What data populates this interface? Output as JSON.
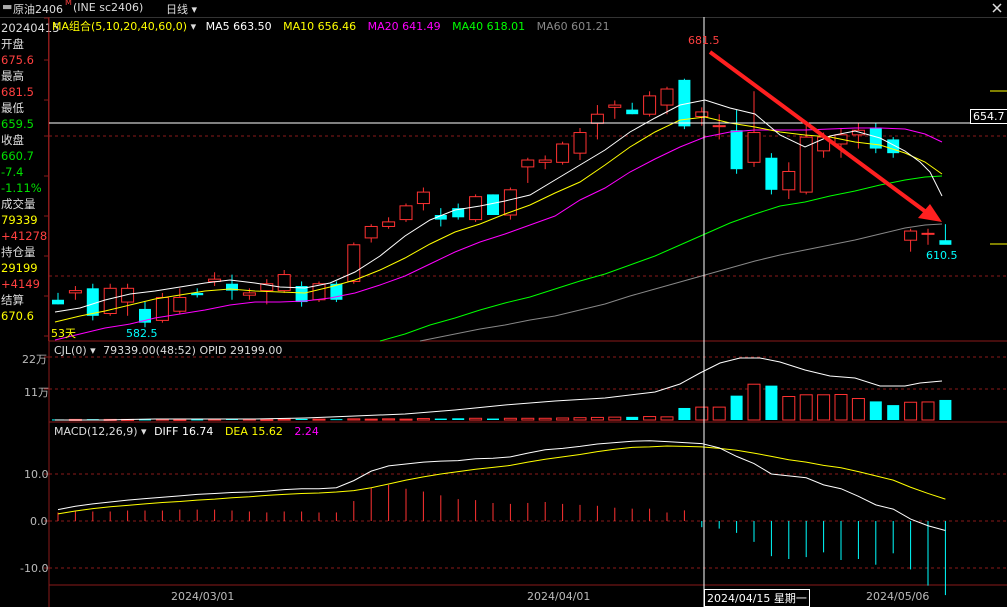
{
  "window": {
    "symbol_label": "原油2406",
    "symbol_code": "(INE sc2406)",
    "period_label": "日线"
  },
  "sidebar": {
    "date": "20240415",
    "open_label": "开盘",
    "open_value": "675.6",
    "high_label": "最高",
    "high_value": "681.5",
    "low_label": "最低",
    "low_value": "659.5",
    "close_label": "收盘",
    "close_value": "660.7",
    "change": "-7.4",
    "change_pct": "-1.11%",
    "volume_label": "成交量",
    "volume_value": "79339",
    "volume_change": "+41278",
    "oi_label": "持仓量",
    "oi_value": "29199",
    "oi_change": "+4149",
    "settle_label": "结算",
    "settle_value": "670.6"
  },
  "main_panel": {
    "ma_group": "MA组合(5,10,20,40,60,0)",
    "ma5": "MA5 663.50",
    "ma10": "MA10 656.46",
    "ma20": "MA20 641.49",
    "ma40": "MA40 618.01",
    "ma60": "MA60 601.21",
    "high_mark": "681.5",
    "low_mark": "582.5",
    "last_low_mark": "610.5",
    "price_tag": "654.7",
    "days_label": "53天"
  },
  "volume_panel": {
    "title": "CJL(0)",
    "values": "79339.00(48:52)  OPID 29199.00",
    "axis_22": "22万",
    "axis_11": "11万"
  },
  "macd_panel": {
    "title": "MACD(12,26,9)",
    "diff": "DIFF 16.74",
    "dea": "DEA 15.62",
    "macd": "2.24",
    "axis": [
      "10.0",
      "0.0",
      "-10.0"
    ]
  },
  "x_axis": {
    "labels": [
      "2024/03/01",
      "2024/04/01",
      "2024/05/06"
    ],
    "crosshair_date": "2024/04/15 星期一"
  },
  "colors": {
    "up": "#ff3232",
    "down": "#00ffff",
    "ma5": "#ffffff",
    "ma10": "#ffff00",
    "ma20": "#ff00ff",
    "ma40": "#00ff00",
    "ma60": "#888888",
    "text_red": "#ff4040",
    "text_green": "#00e000",
    "text_yellow": "#ffff00",
    "grid": "#8a1a1a"
  },
  "chart_data": {
    "type": "candlestick",
    "y_range_price": [
      567,
      708
    ],
    "candles": [
      {
        "o": 585,
        "h": 588,
        "l": 583,
        "c": 583
      },
      {
        "o": 588,
        "h": 591,
        "l": 585,
        "c": 589
      },
      {
        "o": 590,
        "h": 592,
        "l": 576,
        "c": 578
      },
      {
        "o": 579,
        "h": 592,
        "l": 578,
        "c": 590
      },
      {
        "o": 584,
        "h": 592,
        "l": 578,
        "c": 590
      },
      {
        "o": 581,
        "h": 584,
        "l": 573,
        "c": 575
      },
      {
        "o": 576,
        "h": 588,
        "l": 575,
        "c": 586
      },
      {
        "o": 580,
        "h": 590,
        "l": 579,
        "c": 586
      },
      {
        "o": 588,
        "h": 590,
        "l": 586,
        "c": 587
      },
      {
        "o": 593,
        "h": 597,
        "l": 591,
        "c": 594
      },
      {
        "o": 592,
        "h": 596,
        "l": 585,
        "c": 589
      },
      {
        "o": 587,
        "h": 590,
        "l": 585,
        "c": 588
      },
      {
        "o": 589,
        "h": 594,
        "l": 583,
        "c": 592
      },
      {
        "o": 589,
        "h": 598,
        "l": 588,
        "c": 596
      },
      {
        "o": 591,
        "h": 593,
        "l": 582,
        "c": 584
      },
      {
        "o": 585,
        "h": 593,
        "l": 584,
        "c": 592
      },
      {
        "o": 592,
        "h": 593,
        "l": 584,
        "c": 585
      },
      {
        "o": 593,
        "h": 610,
        "l": 592,
        "c": 609
      },
      {
        "o": 612,
        "h": 618,
        "l": 610,
        "c": 617
      },
      {
        "o": 617,
        "h": 621,
        "l": 616,
        "c": 619
      },
      {
        "o": 620,
        "h": 627,
        "l": 619,
        "c": 626
      },
      {
        "o": 627,
        "h": 634,
        "l": 624,
        "c": 632
      },
      {
        "o": 622,
        "h": 625,
        "l": 617,
        "c": 620
      },
      {
        "o": 625,
        "h": 627,
        "l": 620,
        "c": 621
      },
      {
        "o": 620,
        "h": 631,
        "l": 619,
        "c": 630
      },
      {
        "o": 631,
        "h": 631,
        "l": 622,
        "c": 622
      },
      {
        "o": 622,
        "h": 634,
        "l": 620,
        "c": 633
      },
      {
        "o": 643,
        "h": 647,
        "l": 636,
        "c": 646
      },
      {
        "o": 645,
        "h": 648,
        "l": 642,
        "c": 646
      },
      {
        "o": 645,
        "h": 654,
        "l": 644,
        "c": 653
      },
      {
        "o": 649,
        "h": 660,
        "l": 646,
        "c": 658
      },
      {
        "o": 662,
        "h": 670,
        "l": 655,
        "c": 666
      },
      {
        "o": 669,
        "h": 672,
        "l": 664,
        "c": 670
      },
      {
        "o": 668,
        "h": 671,
        "l": 666,
        "c": 666
      },
      {
        "o": 666,
        "h": 676,
        "l": 665,
        "c": 674
      },
      {
        "o": 670,
        "h": 678,
        "l": 666,
        "c": 677
      },
      {
        "o": 681,
        "h": 681.5,
        "l": 659.5,
        "c": 660.7
      },
      {
        "o": 665,
        "h": 669,
        "l": 661,
        "c": 667
      },
      {
        "o": 661,
        "h": 666,
        "l": 655,
        "c": 661
      },
      {
        "o": 659,
        "h": 668,
        "l": 640,
        "c": 642
      },
      {
        "o": 645,
        "h": 676,
        "l": 643,
        "c": 658
      },
      {
        "o": 647,
        "h": 649,
        "l": 631,
        "c": 633
      },
      {
        "o": 633,
        "h": 645,
        "l": 629,
        "c": 641
      },
      {
        "o": 632,
        "h": 663,
        "l": 631,
        "c": 656
      },
      {
        "o": 650,
        "h": 658,
        "l": 647,
        "c": 656
      },
      {
        "o": 653,
        "h": 660,
        "l": 647,
        "c": 657
      },
      {
        "o": 657,
        "h": 662,
        "l": 651,
        "c": 659
      },
      {
        "o": 660,
        "h": 662,
        "l": 649,
        "c": 651
      },
      {
        "o": 655,
        "h": 656,
        "l": 647,
        "c": 649
      },
      {
        "o": 611,
        "h": 616,
        "l": 606,
        "c": 615
      },
      {
        "o": 614,
        "h": 616,
        "l": 609,
        "c": 614
      },
      {
        "o": 611,
        "h": 618,
        "l": 610,
        "c": 609
      }
    ],
    "volume_wan": [
      0.2,
      0.2,
      0.3,
      0.2,
      0.2,
      0.2,
      0.3,
      0.2,
      0.2,
      0.3,
      0.4,
      0.3,
      0.2,
      0.3,
      0.4,
      0.3,
      0.3,
      0.4,
      0.3,
      0.4,
      0.3,
      0.5,
      0.5,
      0.6,
      0.6,
      0.5,
      0.6,
      0.6,
      0.6,
      0.7,
      0.8,
      0.9,
      1.0,
      1.1,
      1.2,
      1.1,
      4.2,
      4.5,
      4.5,
      8.5,
      12.5,
      12.0,
      8.2,
      8.8,
      8.8,
      8.9,
      7.5,
      6.5,
      5.2,
      6.2,
      6.3,
      7.0
    ],
    "macd_diff": [
      2.4,
      3.1,
      3.6,
      4.0,
      4.4,
      4.7,
      5.0,
      5.3,
      5.6,
      5.8,
      6.0,
      6.1,
      6.3,
      6.6,
      6.8,
      6.8,
      7.0,
      8.5,
      10.5,
      11.6,
      12.0,
      12.4,
      12.6,
      12.7,
      13.1,
      13.2,
      13.5,
      14.3,
      15.0,
      15.3,
      15.7,
      16.2,
      16.5,
      16.8,
      16.9,
      16.7,
      16.5,
      16.3,
      15.4,
      13.6,
      12.1,
      9.9,
      9.5,
      9.1,
      7.6,
      6.8,
      5.2,
      3.4,
      2.5,
      0.4,
      -1.0,
      -2.0
    ],
    "macd_dea": [
      1.5,
      2.1,
      2.6,
      3.0,
      3.3,
      3.6,
      3.9,
      4.1,
      4.4,
      4.6,
      4.9,
      5.1,
      5.4,
      5.6,
      5.8,
      5.9,
      6.1,
      6.4,
      7.0,
      7.8,
      8.6,
      9.3,
      9.9,
      10.4,
      10.9,
      11.3,
      11.7,
      12.4,
      13.0,
      13.5,
      14.0,
      14.6,
      15.1,
      15.5,
      15.6,
      15.8,
      15.7,
      15.6,
      15.3,
      14.9,
      14.3,
      13.6,
      12.9,
      12.4,
      11.7,
      11.2,
      10.4,
      9.5,
      8.6,
      7.1,
      5.8,
      4.6
    ],
    "macd_bar": [
      1.8,
      2.0,
      2.0,
      2.0,
      2.2,
      2.2,
      2.2,
      2.4,
      2.4,
      2.4,
      2.2,
      2.0,
      1.8,
      2.0,
      2.0,
      1.8,
      1.8,
      4.2,
      7.0,
      7.6,
      6.8,
      6.2,
      5.4,
      4.6,
      4.4,
      3.8,
      3.6,
      3.8,
      4.0,
      3.6,
      3.4,
      3.2,
      2.8,
      2.6,
      2.6,
      1.8,
      2.24,
      -1.3,
      -1.6,
      -2.5,
      -4.4,
      -7.4,
      -8.0,
      -7.6,
      -6.6,
      -8.2,
      -8.0,
      -9.2,
      -6.8,
      -10.2,
      -13.6,
      -15.6
    ],
    "ma5_pts": [
      [
        55,
        312
      ],
      [
        80,
        308
      ],
      [
        105,
        300
      ],
      [
        130,
        294
      ],
      [
        155,
        291
      ],
      [
        180,
        287
      ],
      [
        205,
        283
      ],
      [
        230,
        280
      ],
      [
        255,
        283
      ],
      [
        280,
        287
      ],
      [
        305,
        288
      ],
      [
        330,
        283
      ],
      [
        355,
        272
      ],
      [
        380,
        256
      ],
      [
        405,
        236
      ],
      [
        430,
        220
      ],
      [
        455,
        210
      ],
      [
        480,
        206
      ],
      [
        505,
        201
      ],
      [
        530,
        195
      ],
      [
        555,
        180
      ],
      [
        580,
        165
      ],
      [
        605,
        150
      ],
      [
        630,
        132
      ],
      [
        655,
        118
      ],
      [
        680,
        105
      ],
      [
        705,
        100
      ],
      [
        730,
        108
      ],
      [
        755,
        114
      ],
      [
        780,
        135
      ],
      [
        805,
        147
      ],
      [
        830,
        136
      ],
      [
        855,
        131
      ],
      [
        880,
        138
      ],
      [
        905,
        151
      ],
      [
        920,
        162
      ],
      [
        930,
        172
      ],
      [
        942,
        196
      ]
    ],
    "ma10_pts": [
      [
        55,
        322
      ],
      [
        80,
        316
      ],
      [
        105,
        311
      ],
      [
        130,
        305
      ],
      [
        155,
        299
      ],
      [
        180,
        295
      ],
      [
        205,
        291
      ],
      [
        230,
        289
      ],
      [
        255,
        291
      ],
      [
        280,
        292
      ],
      [
        305,
        293
      ],
      [
        330,
        287
      ],
      [
        355,
        280
      ],
      [
        380,
        270
      ],
      [
        405,
        258
      ],
      [
        430,
        244
      ],
      [
        455,
        232
      ],
      [
        480,
        224
      ],
      [
        505,
        214
      ],
      [
        530,
        205
      ],
      [
        555,
        193
      ],
      [
        580,
        182
      ],
      [
        605,
        165
      ],
      [
        630,
        147
      ],
      [
        655,
        132
      ],
      [
        680,
        120
      ],
      [
        705,
        117
      ],
      [
        730,
        123
      ],
      [
        755,
        127
      ],
      [
        780,
        132
      ],
      [
        805,
        135
      ],
      [
        830,
        137
      ],
      [
        855,
        142
      ],
      [
        880,
        145
      ],
      [
        905,
        153
      ],
      [
        925,
        162
      ],
      [
        942,
        174
      ]
    ],
    "ma20_pts": [
      [
        55,
        340
      ],
      [
        80,
        334
      ],
      [
        105,
        328
      ],
      [
        130,
        324
      ],
      [
        155,
        318
      ],
      [
        180,
        314
      ],
      [
        205,
        310
      ],
      [
        230,
        305
      ],
      [
        255,
        302
      ],
      [
        280,
        302
      ],
      [
        305,
        301
      ],
      [
        330,
        298
      ],
      [
        355,
        293
      ],
      [
        380,
        285
      ],
      [
        405,
        276
      ],
      [
        430,
        264
      ],
      [
        455,
        252
      ],
      [
        480,
        242
      ],
      [
        505,
        234
      ],
      [
        530,
        225
      ],
      [
        555,
        216
      ],
      [
        580,
        200
      ],
      [
        605,
        188
      ],
      [
        630,
        172
      ],
      [
        655,
        159
      ],
      [
        680,
        147
      ],
      [
        705,
        137
      ],
      [
        730,
        132
      ],
      [
        755,
        130
      ],
      [
        780,
        130
      ],
      [
        805,
        130
      ],
      [
        830,
        129
      ],
      [
        855,
        128
      ],
      [
        880,
        128
      ],
      [
        905,
        129
      ],
      [
        925,
        134
      ],
      [
        942,
        142
      ]
    ],
    "ma40_pts": [
      [
        380,
        341
      ],
      [
        405,
        334
      ],
      [
        430,
        325
      ],
      [
        455,
        318
      ],
      [
        480,
        310
      ],
      [
        505,
        303
      ],
      [
        530,
        297
      ],
      [
        555,
        289
      ],
      [
        580,
        281
      ],
      [
        605,
        274
      ],
      [
        630,
        265
      ],
      [
        655,
        256
      ],
      [
        680,
        245
      ],
      [
        705,
        234
      ],
      [
        730,
        223
      ],
      [
        755,
        214
      ],
      [
        780,
        206
      ],
      [
        805,
        202
      ],
      [
        830,
        196
      ],
      [
        855,
        191
      ],
      [
        880,
        185
      ],
      [
        905,
        180
      ],
      [
        925,
        177
      ],
      [
        942,
        176
      ]
    ],
    "ma60_pts": [
      [
        420,
        341
      ],
      [
        455,
        334
      ],
      [
        480,
        329
      ],
      [
        505,
        325
      ],
      [
        530,
        320
      ],
      [
        555,
        316
      ],
      [
        580,
        310
      ],
      [
        605,
        304
      ],
      [
        630,
        296
      ],
      [
        655,
        289
      ],
      [
        680,
        282
      ],
      [
        705,
        275
      ],
      [
        730,
        268
      ],
      [
        755,
        261
      ],
      [
        780,
        255
      ],
      [
        805,
        250
      ],
      [
        830,
        245
      ],
      [
        855,
        240
      ],
      [
        880,
        234
      ],
      [
        905,
        228
      ],
      [
        925,
        225
      ],
      [
        942,
        224
      ]
    ],
    "vol_line_pts": [
      [
        55,
        420
      ],
      [
        105,
        420
      ],
      [
        155,
        419
      ],
      [
        205,
        419
      ],
      [
        255,
        419
      ],
      [
        305,
        418
      ],
      [
        355,
        416
      ],
      [
        405,
        414
      ],
      [
        455,
        410
      ],
      [
        505,
        405
      ],
      [
        555,
        401
      ],
      [
        605,
        398
      ],
      [
        655,
        392
      ],
      [
        680,
        384
      ],
      [
        700,
        373
      ],
      [
        720,
        363
      ],
      [
        740,
        358
      ],
      [
        760,
        358
      ],
      [
        780,
        362
      ],
      [
        805,
        370
      ],
      [
        830,
        376
      ],
      [
        855,
        378
      ],
      [
        880,
        386
      ],
      [
        905,
        386
      ],
      [
        920,
        383
      ],
      [
        942,
        381
      ]
    ]
  }
}
